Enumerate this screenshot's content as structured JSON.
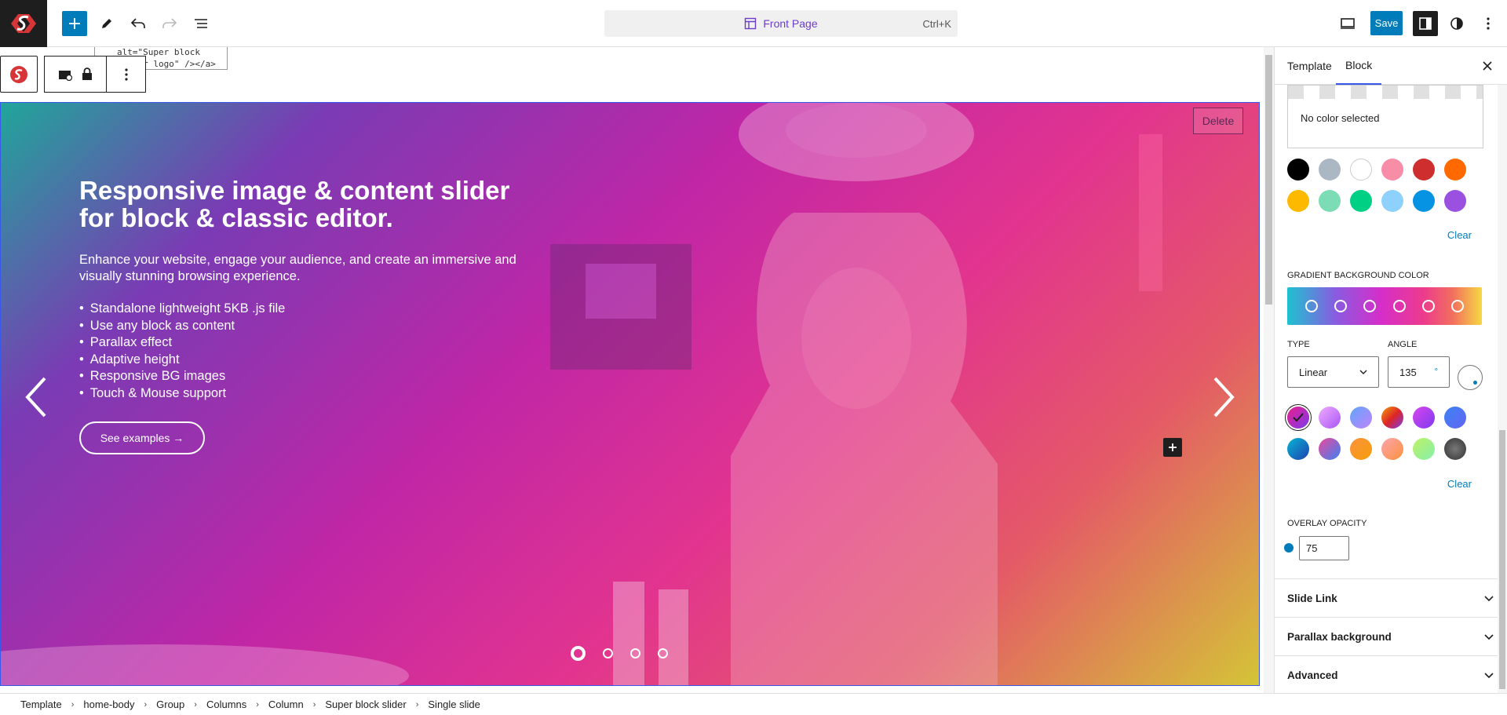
{
  "topbar": {
    "document_title": "Front Page",
    "shortcut": "Ctrl+K",
    "save_label": "Save",
    "icons": [
      "site-logo",
      "plus-icon",
      "pencil-icon",
      "undo-icon",
      "redo-icon",
      "list-view-icon",
      "desktop-preview-icon",
      "settings-sidebar-icon",
      "contrast-icon",
      "more-vertical-icon"
    ]
  },
  "canvas": {
    "code_snippet": "alt=\"Super block\nslider logo\" /></a>",
    "delete_label": "Delete",
    "slide": {
      "title": "Responsive image & content slider for block & classic editor.",
      "description": "Enhance your website, engage your audience, and create an immersive and visually stunning browsing experience.",
      "features": [
        "Standalone lightweight 5KB .js file",
        "Use any block as content",
        "Parallax effect",
        "Adaptive height",
        "Responsive BG images",
        "Touch & Mouse support"
      ],
      "button_label": "See examples →"
    },
    "pagination": {
      "count": 4,
      "active": 1
    }
  },
  "sidebar": {
    "tabs": [
      "Template",
      "Block"
    ],
    "active_tab": "Block",
    "no_color_text": "No color selected",
    "solid_colors": [
      "#000000",
      "#abb8c3",
      "#ffffff",
      "#f78da7",
      "#cf2e2e",
      "#ff6900",
      "#fcb900",
      "#7bdcb5",
      "#00d084",
      "#8ed1fc",
      "#0693e3",
      "#9b51e0"
    ],
    "clear_label": "Clear",
    "gradient_label": "GRADIENT BACKGROUND COLOR",
    "type_label": "TYPE",
    "type_value": "Linear",
    "angle_label": "ANGLE",
    "angle_value": "135",
    "angle_unit": "°",
    "gradient_presets": [
      "linear-gradient(135deg,#e91e8c,#7c3aed)",
      "linear-gradient(135deg,#f0abfc,#a855f7)",
      "linear-gradient(135deg,#60a5fa,#c084fc)",
      "linear-gradient(135deg,#f59e0b,#dc2626,#7c3aed)",
      "linear-gradient(135deg,#d946ef,#7c3aed)",
      "linear-gradient(135deg,#3b82f6,#6366f1)",
      "linear-gradient(135deg,#06b6d4,#1e40af)",
      "linear-gradient(135deg,#ec4899,#3b82f6)",
      "linear-gradient(135deg,#fb923c,#f59e0b)",
      "linear-gradient(135deg,#fda4af,#fb923c)",
      "linear-gradient(135deg,#bef264,#86efac)",
      "radial-gradient(circle,#777 0%,#333 100%)"
    ],
    "overlay_label": "OVERLAY OPACITY",
    "overlay_value": "75",
    "panels": [
      "Slide Link",
      "Parallax background",
      "Advanced"
    ]
  },
  "breadcrumb": [
    "Template",
    "home-body",
    "Group",
    "Columns",
    "Column",
    "Super block slider",
    "Single slide"
  ]
}
